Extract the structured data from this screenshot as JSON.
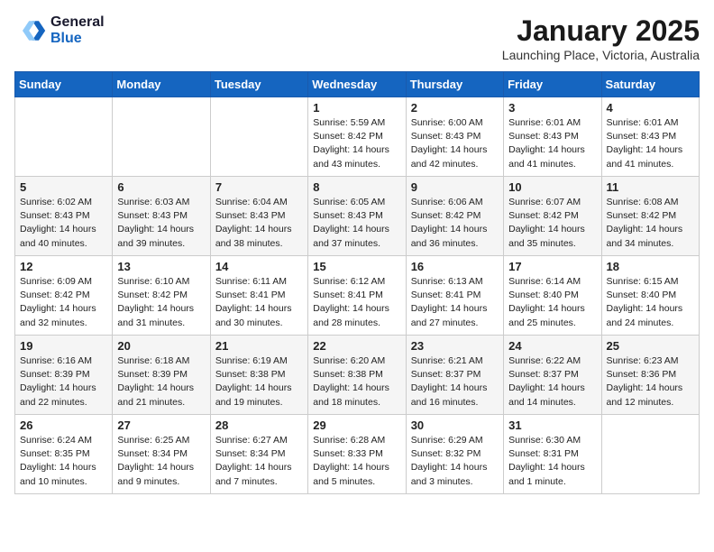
{
  "logo": {
    "line1": "General",
    "line2": "Blue"
  },
  "title": "January 2025",
  "subtitle": "Launching Place, Victoria, Australia",
  "days_of_week": [
    "Sunday",
    "Monday",
    "Tuesday",
    "Wednesday",
    "Thursday",
    "Friday",
    "Saturday"
  ],
  "weeks": [
    [
      {
        "day": "",
        "info": ""
      },
      {
        "day": "",
        "info": ""
      },
      {
        "day": "",
        "info": ""
      },
      {
        "day": "1",
        "info": "Sunrise: 5:59 AM\nSunset: 8:42 PM\nDaylight: 14 hours\nand 43 minutes."
      },
      {
        "day": "2",
        "info": "Sunrise: 6:00 AM\nSunset: 8:43 PM\nDaylight: 14 hours\nand 42 minutes."
      },
      {
        "day": "3",
        "info": "Sunrise: 6:01 AM\nSunset: 8:43 PM\nDaylight: 14 hours\nand 41 minutes."
      },
      {
        "day": "4",
        "info": "Sunrise: 6:01 AM\nSunset: 8:43 PM\nDaylight: 14 hours\nand 41 minutes."
      }
    ],
    [
      {
        "day": "5",
        "info": "Sunrise: 6:02 AM\nSunset: 8:43 PM\nDaylight: 14 hours\nand 40 minutes."
      },
      {
        "day": "6",
        "info": "Sunrise: 6:03 AM\nSunset: 8:43 PM\nDaylight: 14 hours\nand 39 minutes."
      },
      {
        "day": "7",
        "info": "Sunrise: 6:04 AM\nSunset: 8:43 PM\nDaylight: 14 hours\nand 38 minutes."
      },
      {
        "day": "8",
        "info": "Sunrise: 6:05 AM\nSunset: 8:43 PM\nDaylight: 14 hours\nand 37 minutes."
      },
      {
        "day": "9",
        "info": "Sunrise: 6:06 AM\nSunset: 8:42 PM\nDaylight: 14 hours\nand 36 minutes."
      },
      {
        "day": "10",
        "info": "Sunrise: 6:07 AM\nSunset: 8:42 PM\nDaylight: 14 hours\nand 35 minutes."
      },
      {
        "day": "11",
        "info": "Sunrise: 6:08 AM\nSunset: 8:42 PM\nDaylight: 14 hours\nand 34 minutes."
      }
    ],
    [
      {
        "day": "12",
        "info": "Sunrise: 6:09 AM\nSunset: 8:42 PM\nDaylight: 14 hours\nand 32 minutes."
      },
      {
        "day": "13",
        "info": "Sunrise: 6:10 AM\nSunset: 8:42 PM\nDaylight: 14 hours\nand 31 minutes."
      },
      {
        "day": "14",
        "info": "Sunrise: 6:11 AM\nSunset: 8:41 PM\nDaylight: 14 hours\nand 30 minutes."
      },
      {
        "day": "15",
        "info": "Sunrise: 6:12 AM\nSunset: 8:41 PM\nDaylight: 14 hours\nand 28 minutes."
      },
      {
        "day": "16",
        "info": "Sunrise: 6:13 AM\nSunset: 8:41 PM\nDaylight: 14 hours\nand 27 minutes."
      },
      {
        "day": "17",
        "info": "Sunrise: 6:14 AM\nSunset: 8:40 PM\nDaylight: 14 hours\nand 25 minutes."
      },
      {
        "day": "18",
        "info": "Sunrise: 6:15 AM\nSunset: 8:40 PM\nDaylight: 14 hours\nand 24 minutes."
      }
    ],
    [
      {
        "day": "19",
        "info": "Sunrise: 6:16 AM\nSunset: 8:39 PM\nDaylight: 14 hours\nand 22 minutes."
      },
      {
        "day": "20",
        "info": "Sunrise: 6:18 AM\nSunset: 8:39 PM\nDaylight: 14 hours\nand 21 minutes."
      },
      {
        "day": "21",
        "info": "Sunrise: 6:19 AM\nSunset: 8:38 PM\nDaylight: 14 hours\nand 19 minutes."
      },
      {
        "day": "22",
        "info": "Sunrise: 6:20 AM\nSunset: 8:38 PM\nDaylight: 14 hours\nand 18 minutes."
      },
      {
        "day": "23",
        "info": "Sunrise: 6:21 AM\nSunset: 8:37 PM\nDaylight: 14 hours\nand 16 minutes."
      },
      {
        "day": "24",
        "info": "Sunrise: 6:22 AM\nSunset: 8:37 PM\nDaylight: 14 hours\nand 14 minutes."
      },
      {
        "day": "25",
        "info": "Sunrise: 6:23 AM\nSunset: 8:36 PM\nDaylight: 14 hours\nand 12 minutes."
      }
    ],
    [
      {
        "day": "26",
        "info": "Sunrise: 6:24 AM\nSunset: 8:35 PM\nDaylight: 14 hours\nand 10 minutes."
      },
      {
        "day": "27",
        "info": "Sunrise: 6:25 AM\nSunset: 8:34 PM\nDaylight: 14 hours\nand 9 minutes."
      },
      {
        "day": "28",
        "info": "Sunrise: 6:27 AM\nSunset: 8:34 PM\nDaylight: 14 hours\nand 7 minutes."
      },
      {
        "day": "29",
        "info": "Sunrise: 6:28 AM\nSunset: 8:33 PM\nDaylight: 14 hours\nand 5 minutes."
      },
      {
        "day": "30",
        "info": "Sunrise: 6:29 AM\nSunset: 8:32 PM\nDaylight: 14 hours\nand 3 minutes."
      },
      {
        "day": "31",
        "info": "Sunrise: 6:30 AM\nSunset: 8:31 PM\nDaylight: 14 hours\nand 1 minute."
      },
      {
        "day": "",
        "info": ""
      }
    ]
  ]
}
